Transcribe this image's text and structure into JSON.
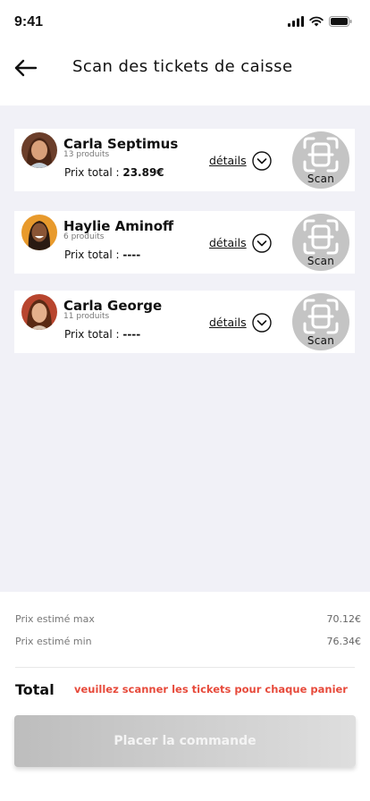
{
  "status_bar": {
    "time": "9:41"
  },
  "header": {
    "title": "Scan des tickets de caisse",
    "back_icon": "arrow-left-icon"
  },
  "baskets": [
    {
      "name": "Carla Septimus",
      "count": "13 produits",
      "price_label": "Prix total :",
      "price": "23.89€",
      "details": "détails",
      "scan": "Scan",
      "avatar_color": "#6b3e2a"
    },
    {
      "name": "Haylie Aminoff",
      "count": "6 produits",
      "price_label": "Prix total :",
      "price": "----",
      "details": "détails",
      "scan": "Scan",
      "avatar_color": "#e89a2c"
    },
    {
      "name": "Carla George",
      "count": "11 produits",
      "price_label": "Prix total :",
      "price": "----",
      "details": "détails",
      "scan": "Scan",
      "avatar_color": "#b8452e"
    }
  ],
  "summary": {
    "max_label": "Prix estimé max",
    "max_value": "70.12€",
    "min_label": "Prix estimé min",
    "min_value": "76.34€",
    "total_label": "Total",
    "warning": "veuillez scanner les tickets pour chaque panier",
    "warning_color": "#e74a3b"
  },
  "order_button": {
    "label": "Placer la commande"
  }
}
